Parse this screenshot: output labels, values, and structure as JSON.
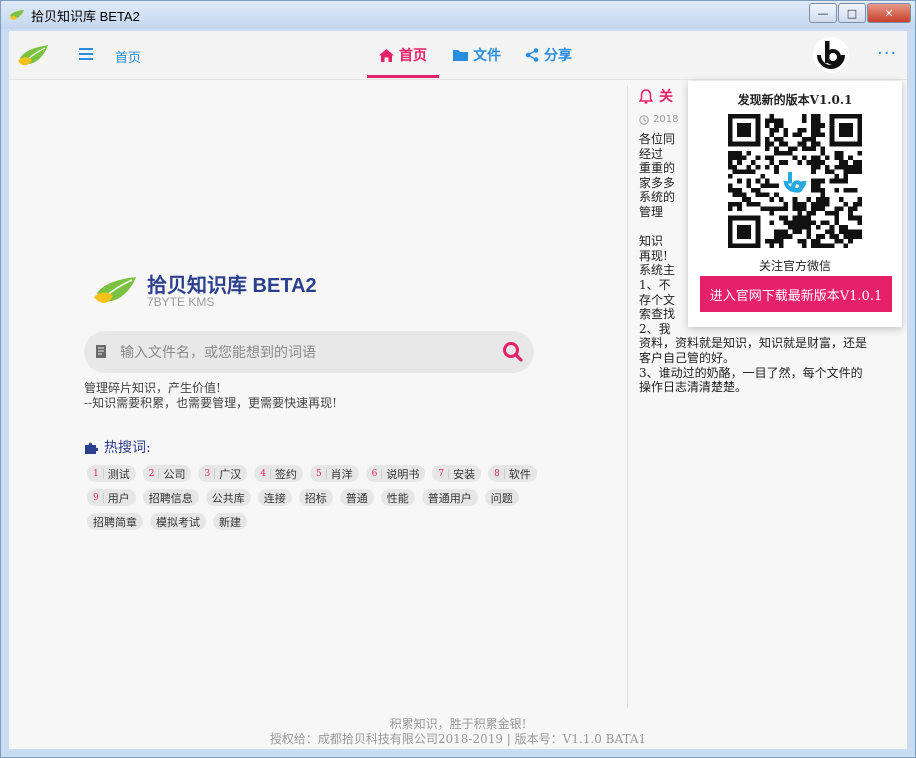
{
  "window": {
    "title": "拾贝知识库 BETA2",
    "minimize_glyph": "—",
    "maximize_glyph": "□",
    "close_glyph": "✕"
  },
  "nav": {
    "home_link": "首页",
    "tabs": [
      {
        "label": "首页",
        "icon": "home-icon",
        "active": true
      },
      {
        "label": "文件",
        "icon": "folder-icon",
        "active": false
      },
      {
        "label": "分享",
        "icon": "share-icon",
        "active": false
      }
    ],
    "more_glyph": "···"
  },
  "brand": {
    "title": "拾贝知识库 BETA2",
    "subtitle": "7BYTE KMS"
  },
  "search": {
    "placeholder": "输入文件名，或您能想到的词语"
  },
  "slogan": {
    "line1": "管理碎片知识，产生价值!",
    "line2": "--知识需要积累，也需要管理，更需要快速再现!"
  },
  "hot": {
    "title": "热搜词:",
    "tags": [
      {
        "num": "1",
        "text": "测试"
      },
      {
        "num": "2",
        "text": "公司"
      },
      {
        "num": "3",
        "text": "广汉"
      },
      {
        "num": "4",
        "text": "签约"
      },
      {
        "num": "5",
        "text": "肖洋"
      },
      {
        "num": "6",
        "text": "说明书"
      },
      {
        "num": "7",
        "text": "安装"
      },
      {
        "num": "8",
        "text": "软件"
      },
      {
        "num": "9",
        "text": "用户"
      },
      {
        "num": "",
        "text": "招聘信息"
      },
      {
        "num": "",
        "text": "公共库"
      },
      {
        "num": "",
        "text": "连接"
      },
      {
        "num": "",
        "text": "招标"
      },
      {
        "num": "",
        "text": "普通"
      },
      {
        "num": "",
        "text": "性能"
      },
      {
        "num": "",
        "text": "普通用户"
      },
      {
        "num": "",
        "text": "问题"
      },
      {
        "num": "",
        "text": "招聘简章"
      },
      {
        "num": "",
        "text": "模拟考试"
      },
      {
        "num": "",
        "text": "新建"
      }
    ]
  },
  "notice": {
    "title": "关",
    "date": "2018",
    "lines": [
      "各位同",
      "  经过",
      "重重的",
      "家多多",
      "系统的",
      "  管理",
      "",
      "  知识",
      "再现!",
      "系统主",
      "1、不",
      "存个文",
      "索查找",
      "2、我",
      "资料，资料就是知识，知识就是财富，还是",
      "客户自己管的好。",
      "3、谁动过的奶酪，一目了然，每个文件的",
      "操作日志清清楚楚。"
    ]
  },
  "popup": {
    "title": "发现新的版本V1.0.1",
    "follow": "关注官方微信",
    "button": "进入官网下载最新版本V1.0.1"
  },
  "footer": {
    "line1": "积累知识，胜于积累金银!",
    "line2": "授权给：成都拾贝科技有限公司2018-2019 | 版本号：V1.1.0 BATA1"
  },
  "colors": {
    "accent": "#e5216a",
    "link_blue": "#2a8ee0",
    "brand_navy": "#2c3f8f"
  }
}
